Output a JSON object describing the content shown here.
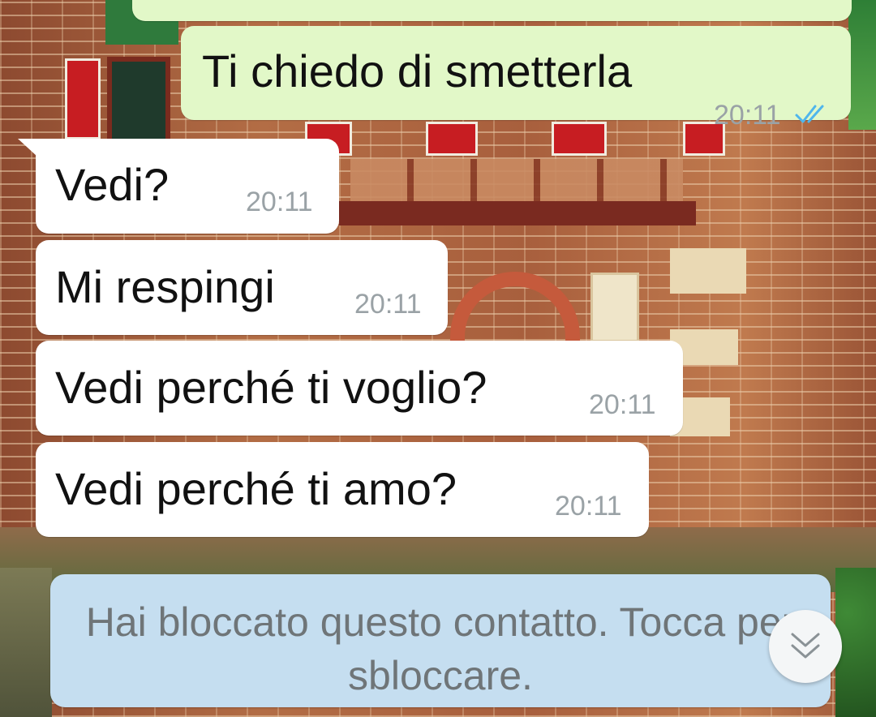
{
  "chat": {
    "messages": [
      {
        "direction": "out",
        "text": "Ti chiedo di smetterla",
        "time": "20:11",
        "status": "read"
      },
      {
        "direction": "in",
        "text": "Vedi?",
        "time": "20:11"
      },
      {
        "direction": "in",
        "text": "Mi respingi",
        "time": "20:11"
      },
      {
        "direction": "in",
        "text": "Vedi perché ti voglio?",
        "time": "20:11"
      },
      {
        "direction": "in",
        "text": "Vedi perché ti amo?",
        "time": "20:11"
      }
    ]
  },
  "banner": {
    "text": "Hai bloccato questo contatto. Tocca per sbloccare."
  },
  "icons": {
    "read_ticks": "double-check-icon",
    "scroll_down": "double-chevron-down-icon"
  },
  "colors": {
    "outgoing_bubble": "#e2f8c8",
    "incoming_bubble": "#ffffff",
    "banner_bg": "#c5def0",
    "read_tick": "#4fb6ec",
    "timestamp": "#9aa2a6"
  }
}
